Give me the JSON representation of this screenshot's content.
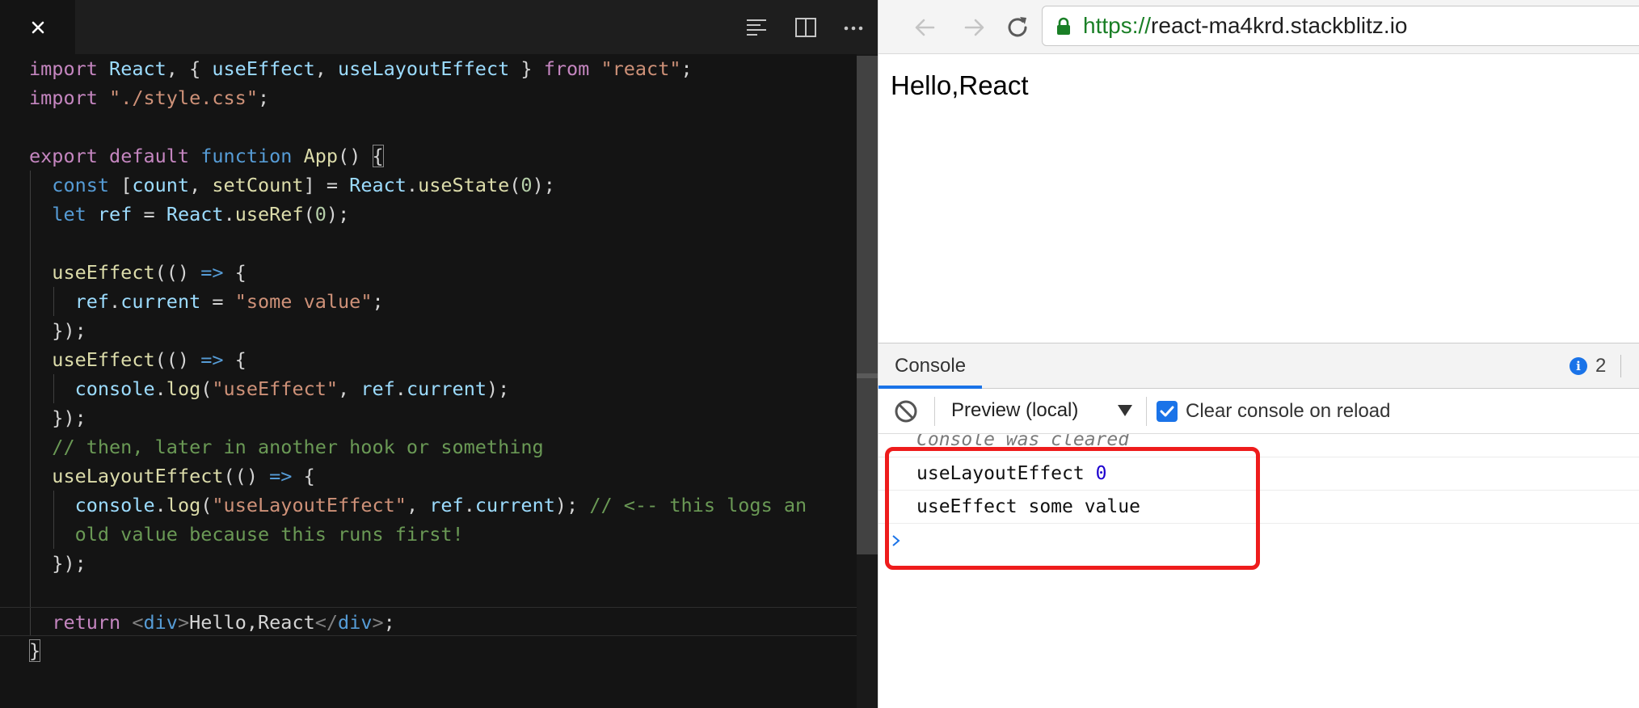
{
  "editor": {
    "code_lines": [
      "import React, { useEffect, useLayoutEffect } from \"react\";",
      "import \"./style.css\";",
      "",
      "export default function App() {",
      "  const [count, setCount] = React.useState(0);",
      "  let ref = React.useRef(0);",
      "",
      "  useEffect(() => {",
      "    ref.current = \"some value\";",
      "  });",
      "  useEffect(() => {",
      "    console.log(\"useEffect\", ref.current);",
      "  });",
      "  // then, later in another hook or something",
      "  useLayoutEffect(() => {",
      "    console.log(\"useLayoutEffect\", ref.current); // <-- this logs an",
      "    old value because this runs first!",
      "  });",
      "",
      "  return <div>Hello,React</div>;",
      "}"
    ],
    "icons": [
      "close-icon",
      "outline-icon",
      "split-editor-icon",
      "more-actions-icon"
    ]
  },
  "browser": {
    "url_scheme": "https://",
    "url_host": "react-ma4krd.stackblitz.io",
    "page_text": "Hello,React",
    "icons": [
      "back-arrow-icon",
      "forward-arrow-icon",
      "reload-icon",
      "lock-icon"
    ]
  },
  "devtools": {
    "tab_label": "Console",
    "info_count": "2",
    "context": "Preview (local)",
    "clear_on_reload_label": "Clear console on reload",
    "clear_on_reload_checked": true,
    "messages": [
      {
        "text": "Console was cleared",
        "kind": "info"
      },
      {
        "text": "useLayoutEffect",
        "value": "0",
        "kind": "log"
      },
      {
        "text": "useEffect some value",
        "kind": "log"
      }
    ]
  },
  "colors": {
    "editor_bg": "#141414",
    "highlight_border": "#ee1c1c",
    "accent_blue": "#1a73e8",
    "secure_green": "#1a7f26"
  }
}
